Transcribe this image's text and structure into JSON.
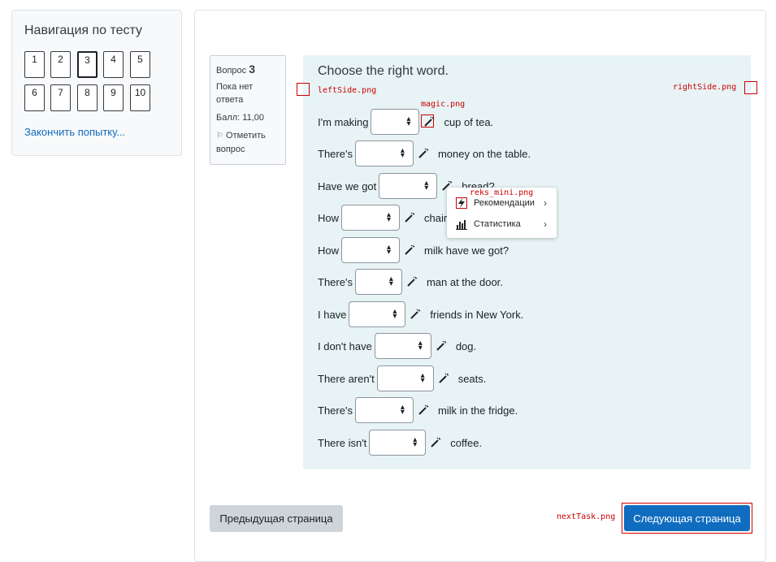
{
  "nav": {
    "title": "Навигация по тесту",
    "buttons": [
      "1",
      "2",
      "3",
      "4",
      "5",
      "6",
      "7",
      "8",
      "9",
      "10"
    ],
    "current": "3",
    "finish_link": "Закончить попытку..."
  },
  "info": {
    "question_label": "Вопрос",
    "question_number": "3",
    "status_line1": "Пока нет",
    "status_line2": "ответа",
    "score": "Балл: 11,00",
    "flag_line1": "Отметить",
    "flag_line2": "вопрос"
  },
  "question": {
    "text": "Choose the right word.",
    "rows": [
      {
        "before": "I'm making",
        "after": "cup of tea."
      },
      {
        "before": "There's",
        "after": "money on the table."
      },
      {
        "before": "Have we got",
        "after": "bread?"
      },
      {
        "before": "How",
        "after": "chairs"
      },
      {
        "before": "How",
        "after": "milk have we got?"
      },
      {
        "before": "There's",
        "after": "man at the door."
      },
      {
        "before": "I have",
        "after": "friends in New York."
      },
      {
        "before": "I don't have",
        "after": "dog."
      },
      {
        "before": "There aren't",
        "after": "seats."
      },
      {
        "before": "There's",
        "after": "milk in the fridge."
      },
      {
        "before": "There isn't",
        "after": "coffee."
      }
    ]
  },
  "markers": {
    "left_side": "leftSide.png",
    "right_side": "rightSide.png",
    "magic": "magic.png",
    "reks_mini": "reks_mini.png",
    "next_task": "nextTask.png"
  },
  "popup": {
    "items": [
      {
        "label": "Рекомендации",
        "icon": "lightning-icon"
      },
      {
        "label": "Статистика",
        "icon": "bar-chart-icon"
      }
    ]
  },
  "footer": {
    "prev_label": "Предыдущая страница",
    "next_label": "Следующая страница"
  },
  "colors": {
    "accent": "#0f6cbf",
    "content_bg": "#e7f3f5",
    "marker": "#cc0000"
  }
}
